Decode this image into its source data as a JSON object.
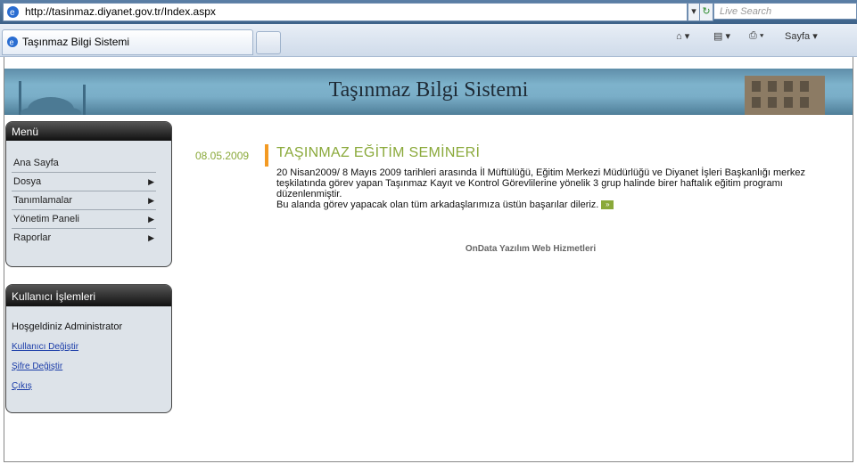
{
  "browser": {
    "url": "http://tasinmaz.diyanet.gov.tr/Index.aspx",
    "search_placeholder": "Live Search",
    "tab_title": "Taşınmaz Bilgi Sistemi",
    "page_menu_label": "Sayfa"
  },
  "banner": {
    "title": "Taşınmaz Bilgi Sistemi"
  },
  "menu": {
    "title": "Menü",
    "items": [
      {
        "label": "Ana Sayfa",
        "submenu": false
      },
      {
        "label": "Dosya",
        "submenu": true
      },
      {
        "label": "Tanımlamalar",
        "submenu": true
      },
      {
        "label": "Yönetim Paneli",
        "submenu": true
      },
      {
        "label": "Raporlar",
        "submenu": true
      }
    ],
    "submenu_arrow": "▶"
  },
  "user_panel": {
    "title": "Kullanıcı İşlemleri",
    "welcome": "Hoşgeldiniz Administrator",
    "links": [
      "Kullanıcı Değiştir",
      "Şifre Değiştir",
      "Çıkış"
    ]
  },
  "news": {
    "date": "08.05.2009",
    "title": "TAŞINMAZ EĞİTİM SEMİNERİ",
    "body_1": "20 Nisan2009/ 8 Mayıs 2009 tarihleri arasında İl Müftülüğü, Eğitim Merkezi Müdürlüğü ve Diyanet İşleri Başkanlığı merkez teşkilatında görev yapan Taşınmaz Kayıt ve Kontrol Görevlilerine yönelik 3 grup halinde birer haftalık eğitim programı düzenlenmiştir.",
    "body_2": "Bu alanda görev yapacak olan tüm arkadaşlarımıza üstün başarılar dileriz.",
    "more_icon": "»"
  },
  "footer": "OnData Yazılım Web Hizmetleri",
  "colors": {
    "accent_green": "#8aa93a",
    "accent_orange": "#f39a23",
    "panel_bg": "#dde3e9"
  }
}
